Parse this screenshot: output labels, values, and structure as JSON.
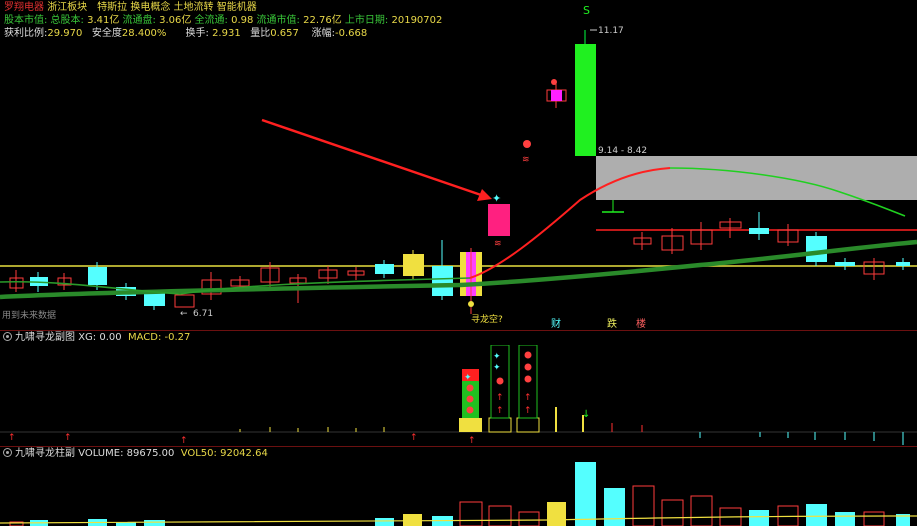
{
  "header": {
    "line1": {
      "stock_name": "罗翔电器",
      "tags": "浙江板块　特斯拉 换电概念 土地流转 智能机器"
    },
    "line2": {
      "total_label": "股本市值: 总股本: ",
      "total_value": "3.41亿",
      "float_label": " 流通盘: ",
      "float_value": "3.06亿",
      "mcap_label": " 全流通: ",
      "mcap_value": "0.98",
      "fmcap_label": " 流通市值: ",
      "fmcap_value": "22.76亿",
      "ipo_label": " 上市日期: ",
      "ipo_value": "20190702"
    },
    "line3": {
      "profit_label": "获利比例:",
      "profit_value": "29.970",
      "safety_label": "安全度",
      "safety_value": "28.400%",
      "turnover_label": "换手:",
      "turnover_value": "2.931",
      "ratio_label": "量比",
      "ratio_value": "0.657",
      "change_label": "涨幅:",
      "change_value": "-0.668"
    }
  },
  "main_chart": {
    "top_marker": "S",
    "high_label": "11.17",
    "range_label": "9.14 - 8.42",
    "low_label": "6.71",
    "future_label": "用到未来数据",
    "badge_cai": "财",
    "badge_die": "跌",
    "badge_lou": "楼",
    "signal_label": "寻龙空?",
    "colors": {
      "up": "#ff3c3c",
      "down": "#54ffff",
      "yellow": "#f0e040",
      "ma_red": "#ff2020",
      "ma_green": "#2a8a2a",
      "zone": "#bbbbbb"
    }
  },
  "panel2": {
    "name": "九啸寻龙副图",
    "xg_label": "XG:",
    "xg_value": "0.00",
    "macd_label": "MACD:",
    "macd_value": "-0.27"
  },
  "panel3": {
    "name": "九啸寻龙柱副",
    "vol_label": "VOLUME:",
    "vol_value": "89675.00",
    "vol50_label": "VOL50:",
    "vol50_value": "92042.64"
  }
}
